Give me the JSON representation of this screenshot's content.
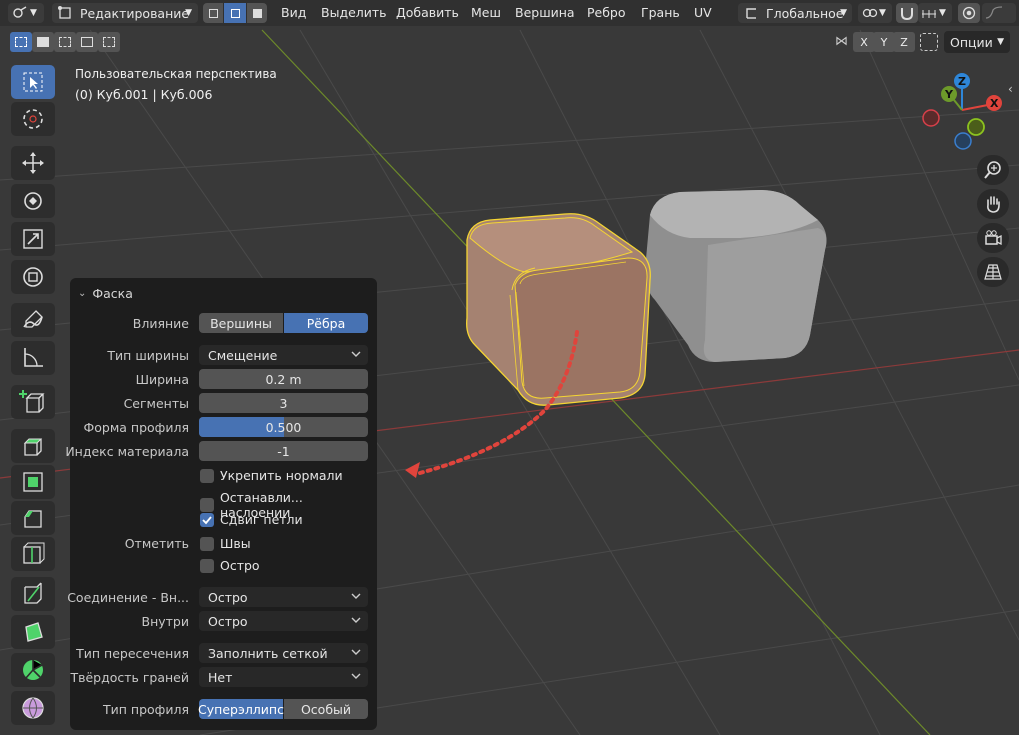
{
  "header": {
    "mode": "Редактирование",
    "menus": [
      "Вид",
      "Выделить",
      "Добавить",
      "Меш",
      "Вершина",
      "Ребро",
      "Грань",
      "UV"
    ],
    "orientation": "Глобальное",
    "options_label": "Опции",
    "axes": [
      "X",
      "Y",
      "Z"
    ]
  },
  "viewport": {
    "view_name": "Пользовательская перспектива",
    "object_info": "(0) Куб.001 | Куб.006",
    "gizmo": {
      "z": "Z",
      "y": "Y",
      "x": "X"
    }
  },
  "panel": {
    "title": "Фаска",
    "influence": {
      "label": "Влияние",
      "options": [
        "Вершины",
        "Рёбра"
      ],
      "selected": "Рёбра"
    },
    "width_type": {
      "label": "Тип ширины",
      "value": "Смещение"
    },
    "width": {
      "label": "Ширина",
      "value": "0.2 m"
    },
    "segments": {
      "label": "Сегменты",
      "value": "3"
    },
    "profile_shape": {
      "label": "Форма профиля",
      "value": "0.500",
      "fraction": 0.5
    },
    "material_index": {
      "label": "Индекс материала",
      "value": "-1"
    },
    "harden_normals": {
      "label": "Укрепить нормали",
      "checked": false
    },
    "clamp_overlap": {
      "label": "Останавли... наслоении",
      "checked": false
    },
    "loop_slide": {
      "label": "Сдвиг петли",
      "checked": true
    },
    "mark": {
      "label": "Отметить",
      "seams": {
        "label": "Швы",
        "checked": false
      },
      "sharp": {
        "label": "Остро",
        "checked": false
      }
    },
    "outer_miter": {
      "label": "Соединение - Вн...",
      "value": "Остро"
    },
    "inner_miter": {
      "label": "Внутри",
      "value": "Остро"
    },
    "intersection_type": {
      "label": "Тип пересечения",
      "value": "Заполнить сеткой"
    },
    "face_strength": {
      "label": "Твёрдость граней",
      "value": "Нет"
    },
    "profile_type": {
      "label": "Тип профиля",
      "options": [
        "Суперэллипс",
        "Особый"
      ],
      "selected": "Суперэллипс"
    }
  },
  "colors": {
    "accent": "#4772b3",
    "selection": "#f5d533",
    "annotation": "#e0443c"
  }
}
